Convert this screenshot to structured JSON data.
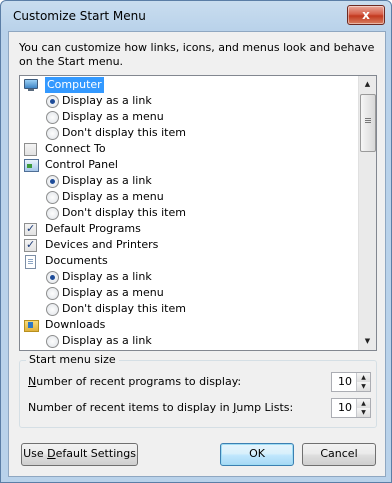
{
  "window": {
    "title": "Customize Start Menu",
    "close_glyph": "x"
  },
  "intro_text": "You can customize how links, icons, and menus look and behave on the Start menu.",
  "list": {
    "computer": {
      "label": "Computer",
      "icon": "computer-icon"
    },
    "computer_opt_link": "Display as a link",
    "computer_opt_menu": "Display as a menu",
    "computer_opt_none": "Don't display this item",
    "connect_to": "Connect To",
    "control_panel": {
      "label": "Control Panel",
      "icon": "control-panel-icon"
    },
    "cp_opt_link": "Display as a link",
    "cp_opt_menu": "Display as a menu",
    "cp_opt_none": "Don't display this item",
    "default_programs": "Default Programs",
    "devices_printers": "Devices and Printers",
    "documents": {
      "label": "Documents",
      "icon": "documents-icon"
    },
    "doc_opt_link": "Display as a link",
    "doc_opt_menu": "Display as a menu",
    "doc_opt_none": "Don't display this item",
    "downloads": {
      "label": "Downloads",
      "icon": "downloads-icon"
    },
    "dl_opt_link": "Display as a link"
  },
  "start_menu_size": {
    "title": "Start menu size",
    "recent_programs_pre": "N",
    "recent_programs_key": "N",
    "recent_programs_rest": "umber of recent programs to display:",
    "recent_programs_value": "10",
    "recent_items_pre": "Number of recent items to display in ",
    "recent_items_key": "J",
    "recent_items_rest": "ump Lists:",
    "recent_items_value": "10"
  },
  "buttons": {
    "default_pre": "Use ",
    "default_key": "D",
    "default_rest": "efault Settings",
    "ok": "OK",
    "cancel": "Cancel"
  },
  "colors": {
    "selection": "#3399ff",
    "close_button": "#c2391f",
    "ok_button": "#bee6fd"
  }
}
